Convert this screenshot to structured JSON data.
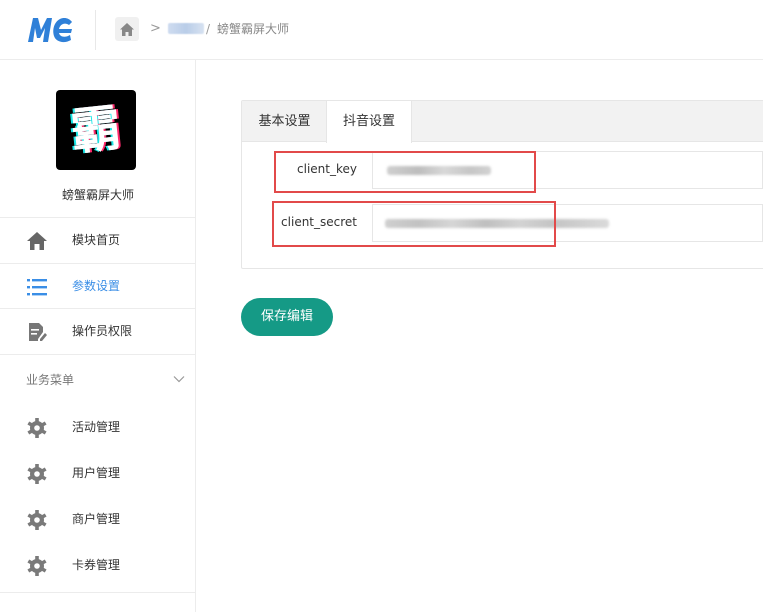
{
  "header": {
    "logo_text": "MC",
    "breadcrumb_current": "螃蟹霸屏大师",
    "breadcrumb_sep": "/",
    "breadcrumb_arrow": ">"
  },
  "sidebar": {
    "avatar_glyph": "霸",
    "app_name": "螃蟹霸屏大师",
    "items": [
      {
        "label": "模块首页",
        "icon": "home-icon",
        "active": false
      },
      {
        "label": "参数设置",
        "icon": "list-icon",
        "active": true
      },
      {
        "label": "操作员权限",
        "icon": "document-edit-icon",
        "active": false
      }
    ],
    "group_title": "业务菜单",
    "group_items": [
      {
        "label": "活动管理",
        "icon": "gear-icon"
      },
      {
        "label": "用户管理",
        "icon": "gear-icon"
      },
      {
        "label": "商户管理",
        "icon": "gear-icon"
      },
      {
        "label": "卡券管理",
        "icon": "gear-icon"
      }
    ]
  },
  "main": {
    "tabs": [
      {
        "label": "基本设置",
        "active": false
      },
      {
        "label": "抖音设置",
        "active": true
      }
    ],
    "fields": [
      {
        "label": "client_key",
        "value": "",
        "value_blurred": true
      },
      {
        "label": "client_secret",
        "value": "",
        "value_blurred": true
      }
    ],
    "save_label": "保存编辑"
  },
  "colors": {
    "accent": "#3a8ee6",
    "primary_button": "#159a86",
    "highlight": "#e24a4a"
  }
}
